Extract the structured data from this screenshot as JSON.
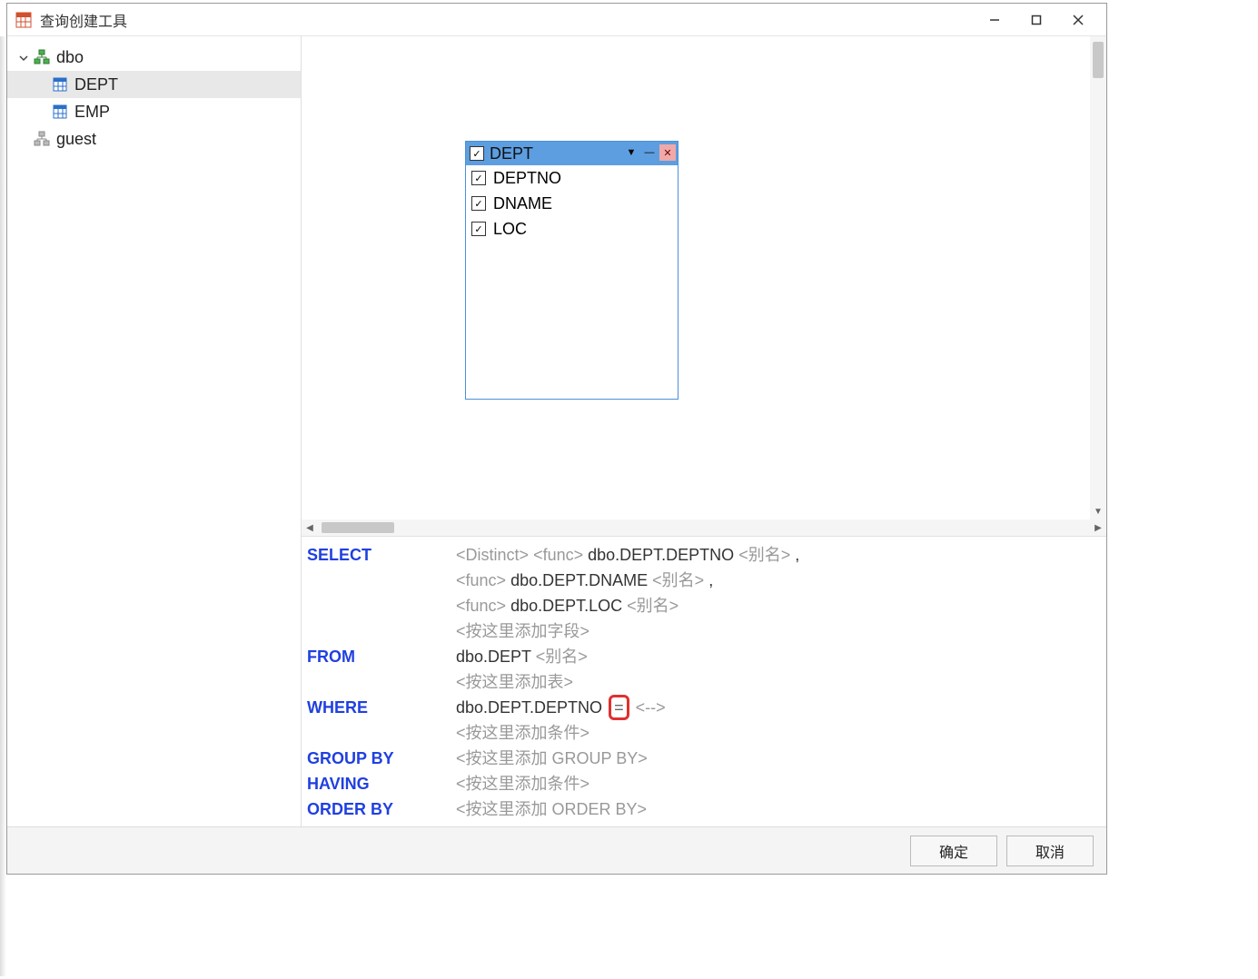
{
  "window": {
    "title": "查询创建工具"
  },
  "sidebar": {
    "tree": [
      {
        "type": "schema",
        "name": "dbo",
        "expanded": true,
        "children": [
          {
            "type": "table",
            "name": "DEPT",
            "selected": true
          },
          {
            "type": "table",
            "name": "EMP",
            "selected": false
          }
        ]
      },
      {
        "type": "schema",
        "name": "guest",
        "expanded": false,
        "children": []
      }
    ]
  },
  "canvas": {
    "table": {
      "name": "DEPT",
      "all_checked": true,
      "columns": [
        {
          "name": "DEPTNO",
          "checked": true
        },
        {
          "name": "DNAME",
          "checked": true
        },
        {
          "name": "LOC",
          "checked": true
        }
      ]
    }
  },
  "sql": {
    "select": {
      "keyword": "SELECT",
      "distinct_ph": "<Distinct>",
      "func_ph": "<func>",
      "alias_ph": "<别名>",
      "fields": [
        {
          "name": "dbo.DEPT.DEPTNO",
          "trailing_comma": true
        },
        {
          "name": "dbo.DEPT.DNAME",
          "trailing_comma": true
        },
        {
          "name": "dbo.DEPT.LOC",
          "trailing_comma": false
        }
      ],
      "add_field_ph": "<按这里添加字段>"
    },
    "from": {
      "keyword": "FROM",
      "table": "dbo.DEPT",
      "alias_ph": "<别名>",
      "add_table_ph": "<按这里添加表>"
    },
    "where": {
      "keyword": "WHERE",
      "field": "dbo.DEPT.DEPTNO",
      "op": "=",
      "value_ph": "<-->",
      "add_cond_ph": "<按这里添加条件>"
    },
    "groupby": {
      "keyword": "GROUP BY",
      "add_ph": "<按这里添加 GROUP BY>"
    },
    "having": {
      "keyword": "HAVING",
      "add_ph": "<按这里添加条件>"
    },
    "orderby": {
      "keyword": "ORDER BY",
      "add_ph": "<按这里添加 ORDER BY>"
    }
  },
  "footer": {
    "ok": "确定",
    "cancel": "取消"
  }
}
